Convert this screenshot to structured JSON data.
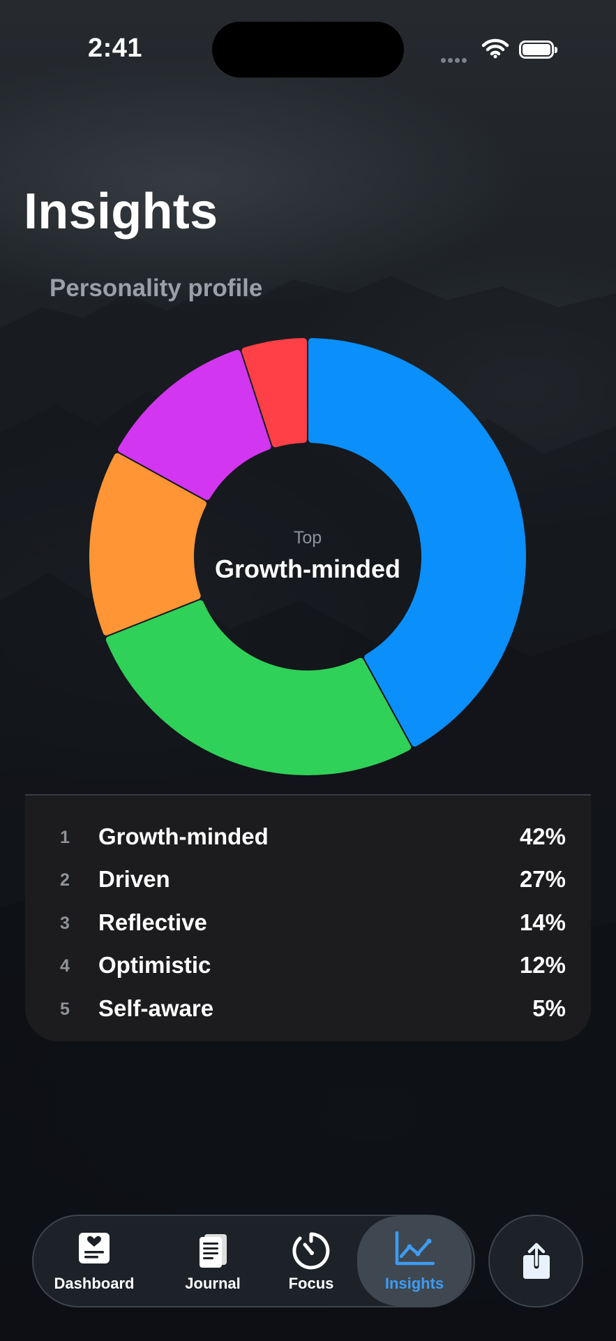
{
  "status_bar": {
    "time": "2:41"
  },
  "header": {
    "title": "Insights"
  },
  "section": {
    "title": "Personality profile"
  },
  "chart_data": {
    "type": "pie",
    "center_label": "Top",
    "center_value": "Growth-minded",
    "slices": [
      {
        "name": "Growth-minded",
        "value": 42,
        "color": "#0a8ffb"
      },
      {
        "name": "Driven",
        "value": 27,
        "color": "#30d158"
      },
      {
        "name": "Reflective",
        "value": 14,
        "color": "#ff9534"
      },
      {
        "name": "Optimistic",
        "value": 12,
        "color": "#d236f0"
      },
      {
        "name": "Self-aware",
        "value": 5,
        "color": "#ff4046"
      }
    ]
  },
  "ranking": [
    {
      "rank": "1",
      "name": "Growth-minded",
      "pct": "42%"
    },
    {
      "rank": "2",
      "name": "Driven",
      "pct": "27%"
    },
    {
      "rank": "3",
      "name": "Reflective",
      "pct": "14%"
    },
    {
      "rank": "4",
      "name": "Optimistic",
      "pct": "12%"
    },
    {
      "rank": "5",
      "name": "Self-aware",
      "pct": "5%"
    }
  ],
  "tabbar": {
    "tabs": [
      {
        "label": "Dashboard",
        "icon": "dashboard-icon"
      },
      {
        "label": "Journal",
        "icon": "journal-icon"
      },
      {
        "label": "Focus",
        "icon": "timer-icon"
      },
      {
        "label": "Insights",
        "icon": "chart-icon",
        "active": true
      }
    ],
    "share_icon": "share-icon",
    "accent_color": "#3e9cf1"
  }
}
